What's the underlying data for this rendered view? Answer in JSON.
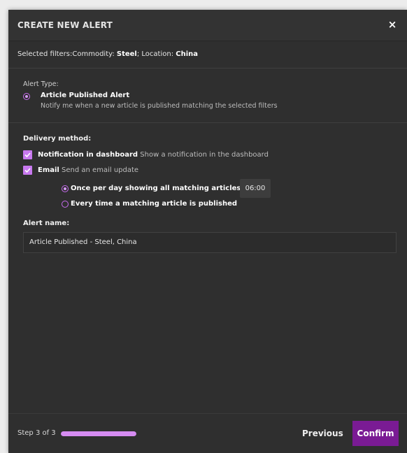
{
  "modal": {
    "title": "CREATE NEW ALERT",
    "close_label": "×"
  },
  "filters": {
    "prefix": "Selected filters:",
    "commodity_key": "Commodity: ",
    "commodity_value": "Steel",
    "separator": "; Location: ",
    "location_value": "China"
  },
  "alert_type": {
    "label": "Alert Type:",
    "option_title": "Article Published Alert",
    "option_desc": "Notify me when a new article is published matching the selected filters",
    "selected": true
  },
  "delivery": {
    "label": "Delivery method:",
    "options": [
      {
        "title": "Notification in dashboard",
        "desc": "Show a notification in the dashboard",
        "checked": true
      },
      {
        "title": "Email",
        "desc": "Send an email update",
        "checked": true
      }
    ],
    "frequency": [
      {
        "label": "Once per day showing all matching articles at",
        "selected": true
      },
      {
        "label": "Every time a matching article is published",
        "selected": false
      }
    ],
    "time_value": "06:00"
  },
  "alert_name": {
    "label": "Alert name:",
    "value": "Article Published - Steel, China"
  },
  "footer": {
    "step_text": "Step 3 of 3",
    "progress_fraction": 1.0,
    "previous_label": "Previous",
    "confirm_label": "Confirm"
  },
  "colors": {
    "accent": "#c879ef",
    "confirm": "#7a1b94",
    "background": "#2f2f2f"
  }
}
